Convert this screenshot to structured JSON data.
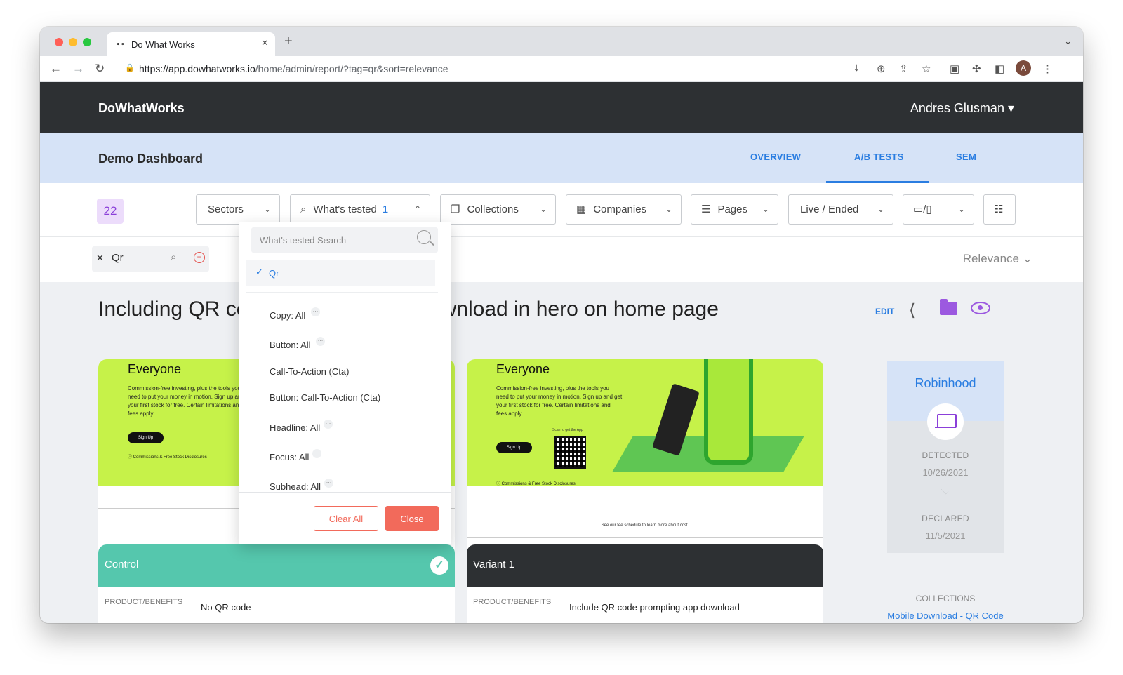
{
  "browser": {
    "tab_title": "Do What Works",
    "url_host": "https://app.dowhatworks.io",
    "url_path": "/home/admin/report/?tag=qr&sort=relevance",
    "avatar_letter": "A"
  },
  "header": {
    "brand": "DoWhatWorks",
    "user": "Andres Glusman ▾"
  },
  "subheader": {
    "title": "Demo Dashboard",
    "tabs": [
      {
        "label": "OVERVIEW"
      },
      {
        "label": "A/B TESTS"
      },
      {
        "label": "SEM"
      }
    ]
  },
  "filters": {
    "count": "22",
    "sectors": "Sectors",
    "whats_tested": "What's tested",
    "whats_tested_count": "1",
    "collections": "Collections",
    "companies": "Companies",
    "pages": "Pages",
    "live_ended": "Live / Ended",
    "device_sep": "/"
  },
  "tagbar": {
    "tag": "Qr",
    "sort": "Relevance"
  },
  "report": {
    "title": "Including QR code prompting app download in hero on home page",
    "edit": "EDIT"
  },
  "cards": {
    "control": {
      "label": "Control",
      "category": "PRODUCT/BENEFITS",
      "description": "No QR code",
      "shot_headline": "Everyone",
      "shot_text": "Commission-free investing, plus the tools you need to put your money in motion. Sign up and get your first stock for free. Certain limitations and fees apply.",
      "shot_button": "Sign Up",
      "shot_disclosure": "ⓘ Commissions & Free Stock Disclosures"
    },
    "variant": {
      "label": "Variant 1",
      "category": "PRODUCT/BENEFITS",
      "description": "Include QR code prompting app download",
      "shot_headline": "Everyone",
      "shot_text": "Commission-free investing, plus the tools you need to put your money in motion. Sign up and get your first stock for free. Certain limitations and fees apply.",
      "shot_button": "Sign Up",
      "shot_disclosure": "ⓘ Commissions & Free Stock Disclosures",
      "shot_qr_caption": "Scan to get the App",
      "shot_footer": "See our fee schedule to learn more about cost."
    }
  },
  "side_panel": {
    "company": "Robinhood",
    "detected_label": "DETECTED",
    "detected_date": "10/26/2021",
    "declared_label": "DECLARED",
    "declared_date": "11/5/2021",
    "collections_label": "COLLECTIONS",
    "collection_link": "Mobile Download - QR Code"
  },
  "dropdown": {
    "search_placeholder": "What's tested Search",
    "selected": "Qr",
    "items": [
      {
        "label": "Copy: All",
        "has_more": true
      },
      {
        "label": "Button: All",
        "has_more": true
      },
      {
        "label": "Call-To-Action (Cta)",
        "has_more": false
      },
      {
        "label": "Button: Call-To-Action (Cta)",
        "has_more": false
      },
      {
        "label": "Headline: All",
        "has_more": true
      },
      {
        "label": "Focus: All",
        "has_more": true
      },
      {
        "label": "Subhead: All",
        "has_more": true
      }
    ],
    "clear_label": "Clear All",
    "close_label": "Close"
  },
  "colors": {
    "accent": "#2a7de1",
    "purple": "#9c59e0",
    "control": "#55c7ad",
    "variant": "#2d3033",
    "danger": "#f26a5b",
    "screenshot_bg": "#c6f249"
  }
}
